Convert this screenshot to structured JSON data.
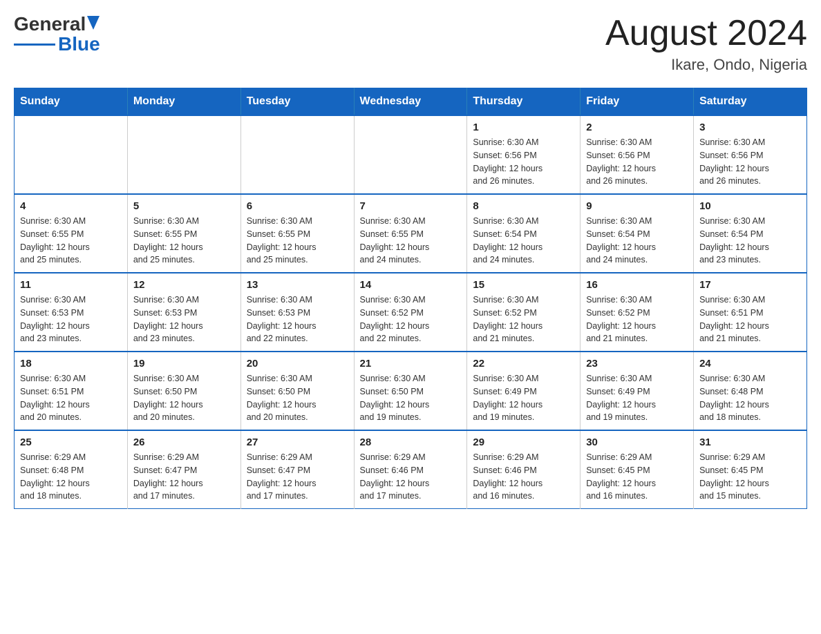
{
  "header": {
    "logo": {
      "general": "General",
      "blue": "Blue"
    },
    "title": "August 2024",
    "subtitle": "Ikare, Ondo, Nigeria"
  },
  "calendar": {
    "days_of_week": [
      "Sunday",
      "Monday",
      "Tuesday",
      "Wednesday",
      "Thursday",
      "Friday",
      "Saturday"
    ],
    "weeks": [
      [
        {
          "day": "",
          "info": ""
        },
        {
          "day": "",
          "info": ""
        },
        {
          "day": "",
          "info": ""
        },
        {
          "day": "",
          "info": ""
        },
        {
          "day": "1",
          "info": "Sunrise: 6:30 AM\nSunset: 6:56 PM\nDaylight: 12 hours\nand 26 minutes."
        },
        {
          "day": "2",
          "info": "Sunrise: 6:30 AM\nSunset: 6:56 PM\nDaylight: 12 hours\nand 26 minutes."
        },
        {
          "day": "3",
          "info": "Sunrise: 6:30 AM\nSunset: 6:56 PM\nDaylight: 12 hours\nand 26 minutes."
        }
      ],
      [
        {
          "day": "4",
          "info": "Sunrise: 6:30 AM\nSunset: 6:55 PM\nDaylight: 12 hours\nand 25 minutes."
        },
        {
          "day": "5",
          "info": "Sunrise: 6:30 AM\nSunset: 6:55 PM\nDaylight: 12 hours\nand 25 minutes."
        },
        {
          "day": "6",
          "info": "Sunrise: 6:30 AM\nSunset: 6:55 PM\nDaylight: 12 hours\nand 25 minutes."
        },
        {
          "day": "7",
          "info": "Sunrise: 6:30 AM\nSunset: 6:55 PM\nDaylight: 12 hours\nand 24 minutes."
        },
        {
          "day": "8",
          "info": "Sunrise: 6:30 AM\nSunset: 6:54 PM\nDaylight: 12 hours\nand 24 minutes."
        },
        {
          "day": "9",
          "info": "Sunrise: 6:30 AM\nSunset: 6:54 PM\nDaylight: 12 hours\nand 24 minutes."
        },
        {
          "day": "10",
          "info": "Sunrise: 6:30 AM\nSunset: 6:54 PM\nDaylight: 12 hours\nand 23 minutes."
        }
      ],
      [
        {
          "day": "11",
          "info": "Sunrise: 6:30 AM\nSunset: 6:53 PM\nDaylight: 12 hours\nand 23 minutes."
        },
        {
          "day": "12",
          "info": "Sunrise: 6:30 AM\nSunset: 6:53 PM\nDaylight: 12 hours\nand 23 minutes."
        },
        {
          "day": "13",
          "info": "Sunrise: 6:30 AM\nSunset: 6:53 PM\nDaylight: 12 hours\nand 22 minutes."
        },
        {
          "day": "14",
          "info": "Sunrise: 6:30 AM\nSunset: 6:52 PM\nDaylight: 12 hours\nand 22 minutes."
        },
        {
          "day": "15",
          "info": "Sunrise: 6:30 AM\nSunset: 6:52 PM\nDaylight: 12 hours\nand 21 minutes."
        },
        {
          "day": "16",
          "info": "Sunrise: 6:30 AM\nSunset: 6:52 PM\nDaylight: 12 hours\nand 21 minutes."
        },
        {
          "day": "17",
          "info": "Sunrise: 6:30 AM\nSunset: 6:51 PM\nDaylight: 12 hours\nand 21 minutes."
        }
      ],
      [
        {
          "day": "18",
          "info": "Sunrise: 6:30 AM\nSunset: 6:51 PM\nDaylight: 12 hours\nand 20 minutes."
        },
        {
          "day": "19",
          "info": "Sunrise: 6:30 AM\nSunset: 6:50 PM\nDaylight: 12 hours\nand 20 minutes."
        },
        {
          "day": "20",
          "info": "Sunrise: 6:30 AM\nSunset: 6:50 PM\nDaylight: 12 hours\nand 20 minutes."
        },
        {
          "day": "21",
          "info": "Sunrise: 6:30 AM\nSunset: 6:50 PM\nDaylight: 12 hours\nand 19 minutes."
        },
        {
          "day": "22",
          "info": "Sunrise: 6:30 AM\nSunset: 6:49 PM\nDaylight: 12 hours\nand 19 minutes."
        },
        {
          "day": "23",
          "info": "Sunrise: 6:30 AM\nSunset: 6:49 PM\nDaylight: 12 hours\nand 19 minutes."
        },
        {
          "day": "24",
          "info": "Sunrise: 6:30 AM\nSunset: 6:48 PM\nDaylight: 12 hours\nand 18 minutes."
        }
      ],
      [
        {
          "day": "25",
          "info": "Sunrise: 6:29 AM\nSunset: 6:48 PM\nDaylight: 12 hours\nand 18 minutes."
        },
        {
          "day": "26",
          "info": "Sunrise: 6:29 AM\nSunset: 6:47 PM\nDaylight: 12 hours\nand 17 minutes."
        },
        {
          "day": "27",
          "info": "Sunrise: 6:29 AM\nSunset: 6:47 PM\nDaylight: 12 hours\nand 17 minutes."
        },
        {
          "day": "28",
          "info": "Sunrise: 6:29 AM\nSunset: 6:46 PM\nDaylight: 12 hours\nand 17 minutes."
        },
        {
          "day": "29",
          "info": "Sunrise: 6:29 AM\nSunset: 6:46 PM\nDaylight: 12 hours\nand 16 minutes."
        },
        {
          "day": "30",
          "info": "Sunrise: 6:29 AM\nSunset: 6:45 PM\nDaylight: 12 hours\nand 16 minutes."
        },
        {
          "day": "31",
          "info": "Sunrise: 6:29 AM\nSunset: 6:45 PM\nDaylight: 12 hours\nand 15 minutes."
        }
      ]
    ]
  }
}
